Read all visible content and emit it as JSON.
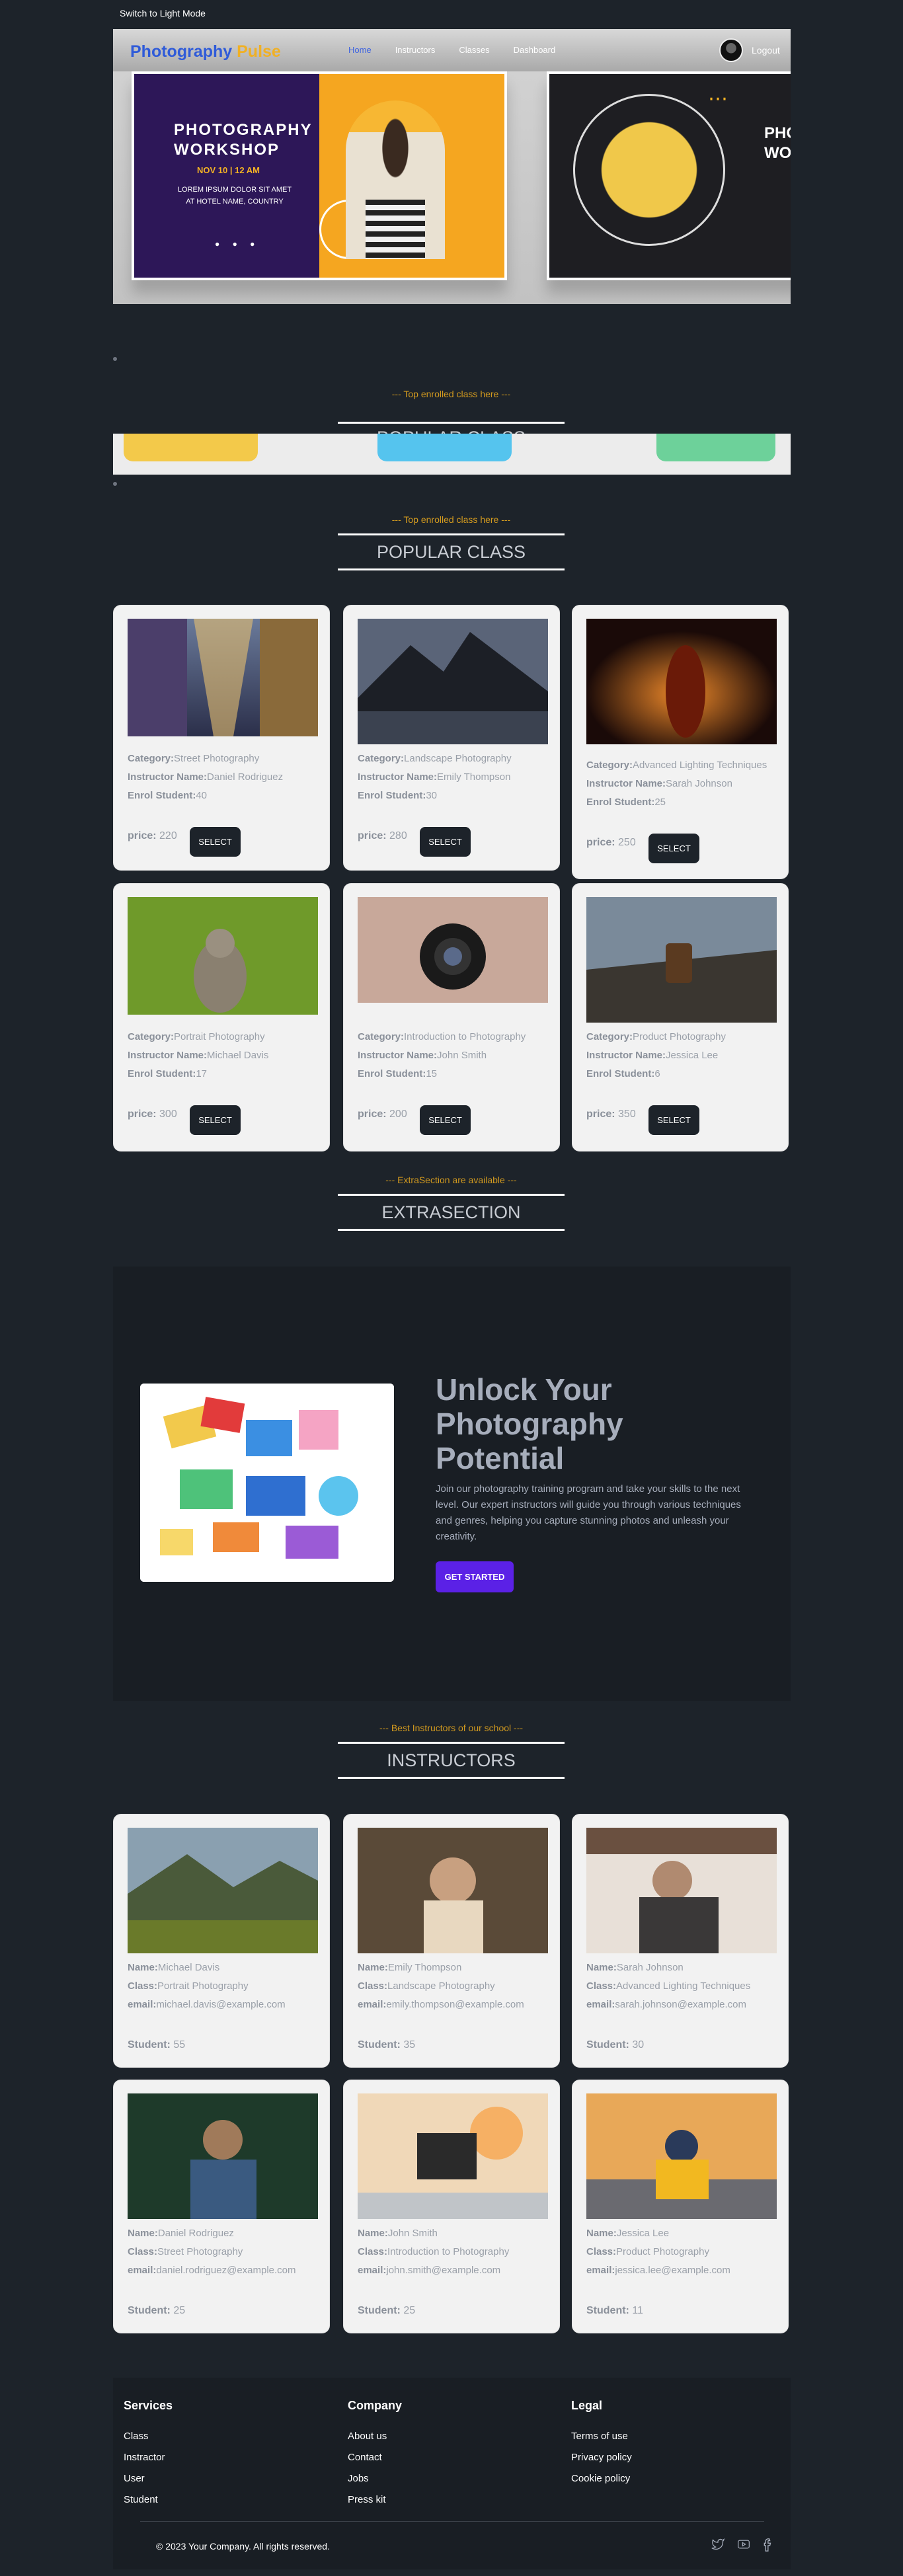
{
  "theme_toggle": "Switch to Light Mode",
  "navbar": {
    "logo_main": "Photography",
    "logo_accent": "Pulse",
    "links": [
      "Home",
      "Instructors",
      "Classes",
      "Dashboard"
    ],
    "logout": "Logout"
  },
  "hero": {
    "slide1_title_line1": "PHOTOGRAPHY",
    "slide1_title_line2": "WORKSHOP",
    "slide1_date": "NOV 10  |  12 AM",
    "slide1_sub": "LOREM IPSUM DOLOR SIT AMET AT HOTEL NAME, COUNTRY",
    "slide2_title_line1": "PHO",
    "slide2_title_line2": "WO"
  },
  "popular_mini": {
    "subtitle": "--- Top enrolled class here ---",
    "title": "POPULAR CLASS"
  },
  "popular": {
    "subtitle": "--- Top enrolled class here ---",
    "title": "POPULAR CLASS",
    "labels": {
      "category": "Category:",
      "instructor": "Instructor Name:",
      "enrol": "Enrol Student:",
      "price": "price:",
      "select": "SELECT"
    },
    "classes": [
      {
        "category": "Street Photography",
        "instructor": "Daniel Rodriguez",
        "enrol": "40",
        "price": "220"
      },
      {
        "category": "Landscape Photography",
        "instructor": "Emily Thompson",
        "enrol": "30",
        "price": "280"
      },
      {
        "category": "Advanced Lighting Techniques",
        "instructor": "Sarah Johnson",
        "enrol": "25",
        "price": "250"
      },
      {
        "category": "Portrait Photography",
        "instructor": "Michael Davis",
        "enrol": "17",
        "price": "300"
      },
      {
        "category": "Introduction to Photography",
        "instructor": "John Smith",
        "enrol": "15",
        "price": "200"
      },
      {
        "category": "Product Photography",
        "instructor": "Jessica Lee",
        "enrol": "6",
        "price": "350"
      }
    ]
  },
  "extra": {
    "subtitle": "--- ExtraSection are available ---",
    "title": "EXTRASECTION",
    "heading": "Unlock Your Photography Potential",
    "description": "Join our photography training program and take your skills to the next level. Our expert instructors will guide you through various techniques and genres, helping you capture stunning photos and unleash your creativity.",
    "button": "GET STARTED"
  },
  "instructors": {
    "subtitle": "--- Best Instructors of our school ---",
    "title": "INSTRUCTORS",
    "labels": {
      "name": "Name:",
      "class": "Class:",
      "email": "email:",
      "student": "Student:"
    },
    "list": [
      {
        "name": "Michael Davis",
        "class": "Portrait Photography",
        "email": "michael.davis@example.com",
        "student": "55"
      },
      {
        "name": "Emily Thompson",
        "class": "Landscape Photography",
        "email": "emily.thompson@example.com",
        "student": "35"
      },
      {
        "name": "Sarah Johnson",
        "class": "Advanced Lighting Techniques",
        "email": "sarah.johnson@example.com",
        "student": "30"
      },
      {
        "name": "Daniel Rodriguez",
        "class": "Street Photography",
        "email": "daniel.rodriguez@example.com",
        "student": "25"
      },
      {
        "name": "John Smith",
        "class": "Introduction to Photography",
        "email": "john.smith@example.com",
        "student": "25"
      },
      {
        "name": "Jessica Lee",
        "class": "Product Photography",
        "email": "jessica.lee@example.com",
        "student": "11"
      }
    ]
  },
  "footer": {
    "services_title": "Services",
    "services": [
      "Class",
      "Instractor",
      "User",
      "Student"
    ],
    "company_title": "Company",
    "company": [
      "About us",
      "Contact",
      "Jobs",
      "Press kit"
    ],
    "legal_title": "Legal",
    "legal": [
      "Terms of use",
      "Privacy policy",
      "Cookie policy"
    ],
    "copyright": "© 2023 Your Company. All rights reserved.",
    "icons": [
      "twitter-icon",
      "youtube-icon",
      "facebook-icon"
    ]
  },
  "colors": {
    "background": "#1d232a",
    "accent_orange": "#d29a1f",
    "brand_blue": "#2f5bd9",
    "button_purple": "#5b21e6"
  }
}
